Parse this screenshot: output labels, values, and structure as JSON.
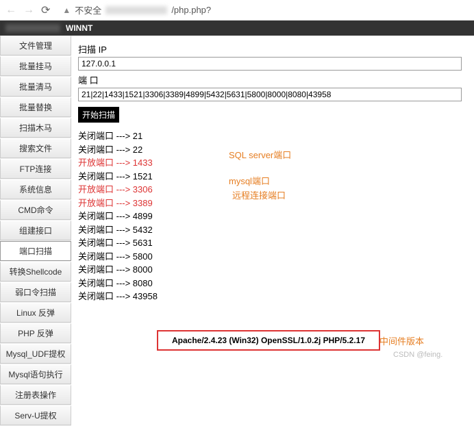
{
  "browser": {
    "insecure_label": "不安全",
    "url_suffix": "/php.php?"
  },
  "header": {
    "title": "WINNT"
  },
  "sidebar": {
    "items": [
      {
        "label": "文件管理"
      },
      {
        "label": "批量挂马"
      },
      {
        "label": "批量清马"
      },
      {
        "label": "批量替换"
      },
      {
        "label": "扫描木马"
      },
      {
        "label": "搜索文件"
      },
      {
        "label": "FTP连接"
      },
      {
        "label": "系统信息"
      },
      {
        "label": "CMD命令"
      },
      {
        "label": "组建接口"
      },
      {
        "label": "端口扫描"
      },
      {
        "label": "转换Shellcode"
      },
      {
        "label": "弱口令扫描"
      },
      {
        "label": "Linux 反弹"
      },
      {
        "label": "PHP 反弹"
      },
      {
        "label": "Mysql_UDF提权"
      },
      {
        "label": "Mysql语句执行"
      },
      {
        "label": "注册表操作"
      },
      {
        "label": "Serv-U提权"
      }
    ],
    "active_index": 10
  },
  "form": {
    "ip_label": "扫描 IP",
    "ip_value": "127.0.0.1",
    "port_label": "端 口",
    "port_value": "21|22|1433|1521|3306|3389|4899|5432|5631|5800|8000|8080|43958",
    "scan_button": "开始扫描"
  },
  "results": {
    "lines": [
      {
        "text": "关闭端口 ---> 21",
        "open": false
      },
      {
        "text": "关闭端口 ---> 22",
        "open": false
      },
      {
        "text": "开放端口 ---> 1433",
        "open": true
      },
      {
        "text": "关闭端口 ---> 1521",
        "open": false
      },
      {
        "text": "开放端口 ---> 3306",
        "open": true
      },
      {
        "text": "开放端口 ---> 3389",
        "open": true
      },
      {
        "text": "关闭端口 ---> 4899",
        "open": false
      },
      {
        "text": "关闭端口 ---> 5432",
        "open": false
      },
      {
        "text": "关闭端口 ---> 5631",
        "open": false
      },
      {
        "text": "关闭端口 ---> 5800",
        "open": false
      },
      {
        "text": "关闭端口 ---> 8000",
        "open": false
      },
      {
        "text": "关闭端口 ---> 8080",
        "open": false
      },
      {
        "text": "关闭端口 ---> 43958",
        "open": false
      }
    ]
  },
  "annotations": {
    "a1": "SQL server端口",
    "a2": "mysql端口",
    "a3": "远程连接端口",
    "footer": "中间件版本"
  },
  "footer": {
    "server_info": "Apache/2.4.23 (Win32) OpenSSL/1.0.2j PHP/5.2.17"
  },
  "watermark": "CSDN @feing."
}
